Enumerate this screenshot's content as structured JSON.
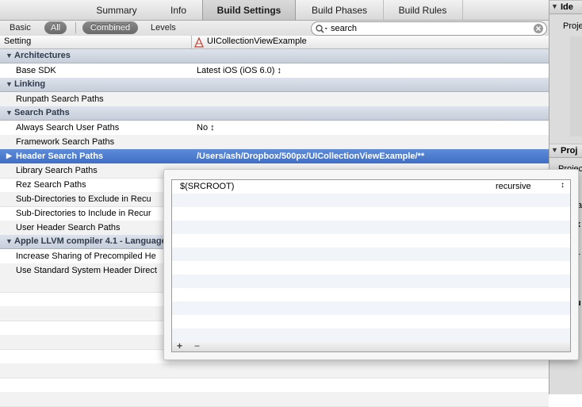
{
  "tabs": [
    "Summary",
    "Info",
    "Build Settings",
    "Build Phases",
    "Build Rules"
  ],
  "filter": {
    "basic": "Basic",
    "all": "All",
    "combined": "Combined",
    "levels": "Levels"
  },
  "search": {
    "value": "search"
  },
  "header": {
    "setting": "Setting",
    "target": "UICollectionViewExample"
  },
  "rows": [
    {
      "kind": "group",
      "label": "Architectures"
    },
    {
      "kind": "row",
      "label": "Base SDK",
      "value": "Latest iOS (iOS 6.0) ↕"
    },
    {
      "kind": "group",
      "label": "Linking"
    },
    {
      "kind": "row",
      "label": "Runpath Search Paths",
      "value": ""
    },
    {
      "kind": "group",
      "label": "Search Paths"
    },
    {
      "kind": "row",
      "label": "Always Search User Paths",
      "value": "No ↕"
    },
    {
      "kind": "row",
      "label": "Framework Search Paths",
      "value": ""
    },
    {
      "kind": "selected",
      "label": "Header Search Paths",
      "value": "/Users/ash/Dropbox/500px/UICollectionViewExample/**"
    },
    {
      "kind": "row",
      "label": "Library Search Paths",
      "value": ""
    },
    {
      "kind": "row",
      "label": "Rez Search Paths",
      "value": ""
    },
    {
      "kind": "row",
      "label": "Sub-Directories to Exclude in Recu",
      "value": ""
    },
    {
      "kind": "row",
      "label": "Sub-Directories to Include in Recur",
      "value": ""
    },
    {
      "kind": "row",
      "label": "User Header Search Paths",
      "value": ""
    },
    {
      "kind": "group",
      "label": "Apple LLVM compiler 4.1 - Language"
    },
    {
      "kind": "row",
      "label": "Increase Sharing of Precompiled He",
      "value": ""
    },
    {
      "kind": "row",
      "label": "Use Standard System Header Direct",
      "value": ""
    }
  ],
  "popover": {
    "entries": [
      {
        "path": "$(SRCROOT)",
        "mode": "recursive"
      }
    ],
    "add": "+",
    "remove": "−"
  },
  "inspector": {
    "section1": "Ide",
    "label1": "Proje",
    "section2": "Proj",
    "label2": "Project",
    "frag1": "t",
    "frag2": "a",
    "frag3": "as",
    "frag4": "x",
    "frag5": "r",
    "frag6": "u"
  },
  "colors": {
    "selection": "#3f6ec4",
    "group": "#c6ced9",
    "pill": "#777777"
  }
}
